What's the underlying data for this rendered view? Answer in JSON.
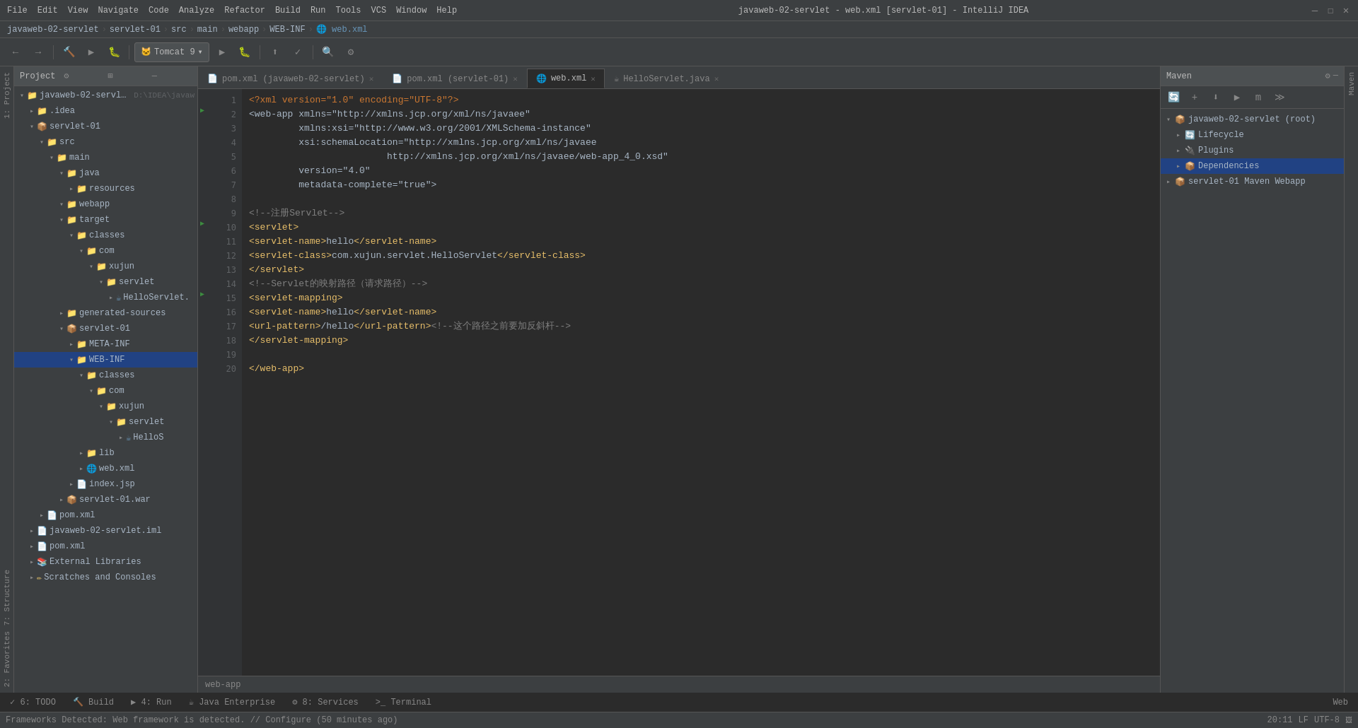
{
  "window": {
    "title": "javaweb-02-servlet - web.xml [servlet-01] - IntelliJ IDEA",
    "controls": [
      "—",
      "☐",
      "✕"
    ]
  },
  "menu": {
    "items": [
      "File",
      "Edit",
      "View",
      "Navigate",
      "Code",
      "Analyze",
      "Refactor",
      "Build",
      "Run",
      "Tools",
      "VCS",
      "Window",
      "Help"
    ]
  },
  "breadcrumb": {
    "parts": [
      "javaweb-02-servlet",
      "servlet-01",
      "src",
      "main",
      "webapp",
      "WEB-INF",
      "web.xml"
    ]
  },
  "tomcat": {
    "label": "Tomcat 9"
  },
  "tabs": [
    {
      "label": "pom.xml (javaweb-02-servlet)",
      "icon": "📄",
      "active": false
    },
    {
      "label": "pom.xml (servlet-01)",
      "icon": "📄",
      "active": false
    },
    {
      "label": "web.xml",
      "icon": "🌐",
      "active": true
    },
    {
      "label": "HelloServlet.java",
      "icon": "☕",
      "active": false
    }
  ],
  "project_panel": {
    "title": "Project"
  },
  "tree": [
    {
      "level": 0,
      "expanded": true,
      "icon": "📁",
      "label": "javaweb-02-servlet",
      "extra": "D:\\IDEA\\javaw",
      "type": "project"
    },
    {
      "level": 1,
      "expanded": false,
      "icon": "📁",
      "label": ".idea",
      "type": "folder"
    },
    {
      "level": 1,
      "expanded": true,
      "icon": "📦",
      "label": "servlet-01",
      "type": "module"
    },
    {
      "level": 2,
      "expanded": true,
      "icon": "📁",
      "label": "src",
      "type": "folder"
    },
    {
      "level": 3,
      "expanded": true,
      "icon": "📁",
      "label": "main",
      "type": "folder"
    },
    {
      "level": 4,
      "expanded": true,
      "icon": "📁",
      "label": "java",
      "type": "folder"
    },
    {
      "level": 5,
      "expanded": false,
      "icon": "📁",
      "label": "resources",
      "type": "folder"
    },
    {
      "level": 4,
      "expanded": true,
      "icon": "📁",
      "label": "webapp",
      "type": "folder"
    },
    {
      "level": 4,
      "expanded": true,
      "icon": "📁",
      "label": "target",
      "type": "folder",
      "highlight": true
    },
    {
      "level": 5,
      "expanded": true,
      "icon": "📁",
      "label": "classes",
      "type": "folder"
    },
    {
      "level": 6,
      "expanded": true,
      "icon": "📁",
      "label": "com",
      "type": "folder"
    },
    {
      "level": 7,
      "expanded": true,
      "icon": "📁",
      "label": "xujun",
      "type": "folder"
    },
    {
      "level": 8,
      "expanded": true,
      "icon": "📁",
      "label": "servlet",
      "type": "folder"
    },
    {
      "level": 9,
      "expanded": false,
      "icon": "☕",
      "label": "HelloServlet.",
      "type": "java"
    },
    {
      "level": 4,
      "expanded": false,
      "icon": "📁",
      "label": "generated-sources",
      "type": "folder"
    },
    {
      "level": 4,
      "expanded": true,
      "icon": "📦",
      "label": "servlet-01",
      "type": "module"
    },
    {
      "level": 5,
      "expanded": false,
      "icon": "📁",
      "label": "META-INF",
      "type": "folder"
    },
    {
      "level": 5,
      "expanded": true,
      "icon": "📁",
      "label": "WEB-INF",
      "type": "folder",
      "highlight2": true
    },
    {
      "level": 6,
      "expanded": true,
      "icon": "📁",
      "label": "classes",
      "type": "folder"
    },
    {
      "level": 7,
      "expanded": true,
      "icon": "📁",
      "label": "com",
      "type": "folder"
    },
    {
      "level": 8,
      "expanded": true,
      "icon": "📁",
      "label": "xujun",
      "type": "folder"
    },
    {
      "level": 9,
      "expanded": true,
      "icon": "📁",
      "label": "servlet",
      "type": "folder"
    },
    {
      "level": 10,
      "expanded": false,
      "icon": "☕",
      "label": "HelloS",
      "type": "java"
    },
    {
      "level": 6,
      "expanded": false,
      "icon": "📁",
      "label": "lib",
      "type": "folder"
    },
    {
      "level": 6,
      "expanded": false,
      "icon": "🌐",
      "label": "web.xml",
      "type": "xml"
    },
    {
      "level": 5,
      "expanded": false,
      "icon": "📄",
      "label": "index.jsp",
      "type": "jsp"
    },
    {
      "level": 4,
      "expanded": false,
      "icon": "📦",
      "label": "servlet-01.war",
      "type": "war"
    },
    {
      "level": 2,
      "expanded": false,
      "icon": "📄",
      "label": "pom.xml",
      "type": "xml"
    },
    {
      "level": 1,
      "expanded": false,
      "icon": "📄",
      "label": "javaweb-02-servlet.iml",
      "type": "iml"
    },
    {
      "level": 1,
      "expanded": false,
      "icon": "📄",
      "label": "pom.xml",
      "type": "xml"
    },
    {
      "level": 1,
      "expanded": false,
      "icon": "📚",
      "label": "External Libraries",
      "type": "lib"
    },
    {
      "level": 1,
      "expanded": false,
      "icon": "✏️",
      "label": "Scratches and Consoles",
      "type": "scratch"
    }
  ],
  "code_lines": [
    {
      "num": 1,
      "content": "<?xml version=\"1.0\" encoding=\"UTF-8\"?>"
    },
    {
      "num": 2,
      "content": "<web-app xmlns=\"http://xmlns.jcp.org/xml/ns/javaee\""
    },
    {
      "num": 3,
      "content": "         xmlns:xsi=\"http://www.w3.org/2001/XMLSchema-instance\""
    },
    {
      "num": 4,
      "content": "         xsi:schemaLocation=\"http://xmlns.jcp.org/xml/ns/javaee"
    },
    {
      "num": 5,
      "content": "                         http://xmlns.jcp.org/xml/ns/javaee/web-app_4_0.xsd\""
    },
    {
      "num": 6,
      "content": "         version=\"4.0\""
    },
    {
      "num": 7,
      "content": "         metadata-complete=\"true\">"
    },
    {
      "num": 8,
      "content": ""
    },
    {
      "num": 9,
      "content": "    <!--注册Servlet-->"
    },
    {
      "num": 10,
      "content": "    <servlet>"
    },
    {
      "num": 11,
      "content": "        <servlet-name>hello</servlet-name>"
    },
    {
      "num": 12,
      "content": "        <servlet-class>com.xujun.servlet.HelloServlet</servlet-class>"
    },
    {
      "num": 13,
      "content": "    </servlet>"
    },
    {
      "num": 14,
      "content": "    <!--Servlet的映射路径（请求路径）-->"
    },
    {
      "num": 15,
      "content": "    <servlet-mapping>"
    },
    {
      "num": 16,
      "content": "        <servlet-name>hello</servlet-name>"
    },
    {
      "num": 17,
      "content": "        <url-pattern>/hello</url-pattern><!--这个路径之前要加反斜杆-->"
    },
    {
      "num": 18,
      "content": "    </servlet-mapping>"
    },
    {
      "num": 19,
      "content": ""
    },
    {
      "num": 20,
      "content": "</web-app>"
    }
  ],
  "maven": {
    "title": "Maven",
    "items": [
      {
        "level": 0,
        "expanded": true,
        "icon": "📦",
        "label": "javaweb-02-servlet (root)"
      },
      {
        "level": 1,
        "expanded": false,
        "icon": "🔄",
        "label": "Lifecycle"
      },
      {
        "level": 1,
        "expanded": false,
        "icon": "🔌",
        "label": "Plugins"
      },
      {
        "level": 1,
        "expanded": false,
        "icon": "📦",
        "label": "Dependencies",
        "selected": true
      },
      {
        "level": 0,
        "expanded": false,
        "icon": "📦",
        "label": "servlet-01 Maven Webapp"
      }
    ]
  },
  "bottom_tabs": [
    {
      "label": "6: TODO",
      "icon": "✓"
    },
    {
      "label": "Build",
      "icon": "🔨"
    },
    {
      "label": "4: Run",
      "icon": "▶"
    },
    {
      "label": "Java Enterprise",
      "icon": "☕"
    },
    {
      "label": "8: Services",
      "icon": "⚙"
    },
    {
      "label": "Terminal",
      "icon": ">_"
    }
  ],
  "status_bar": {
    "message": "Frameworks Detected: Web framework is detected. // Configure (50 minutes ago)",
    "position": "20:11",
    "encoding": "LF  UTF-8"
  },
  "footer_label": "web-app",
  "side_labels": {
    "project": "1: Project",
    "structure": "7: Structure",
    "favorites": "2: Favorites",
    "web": "Web",
    "maven": "Maven"
  }
}
